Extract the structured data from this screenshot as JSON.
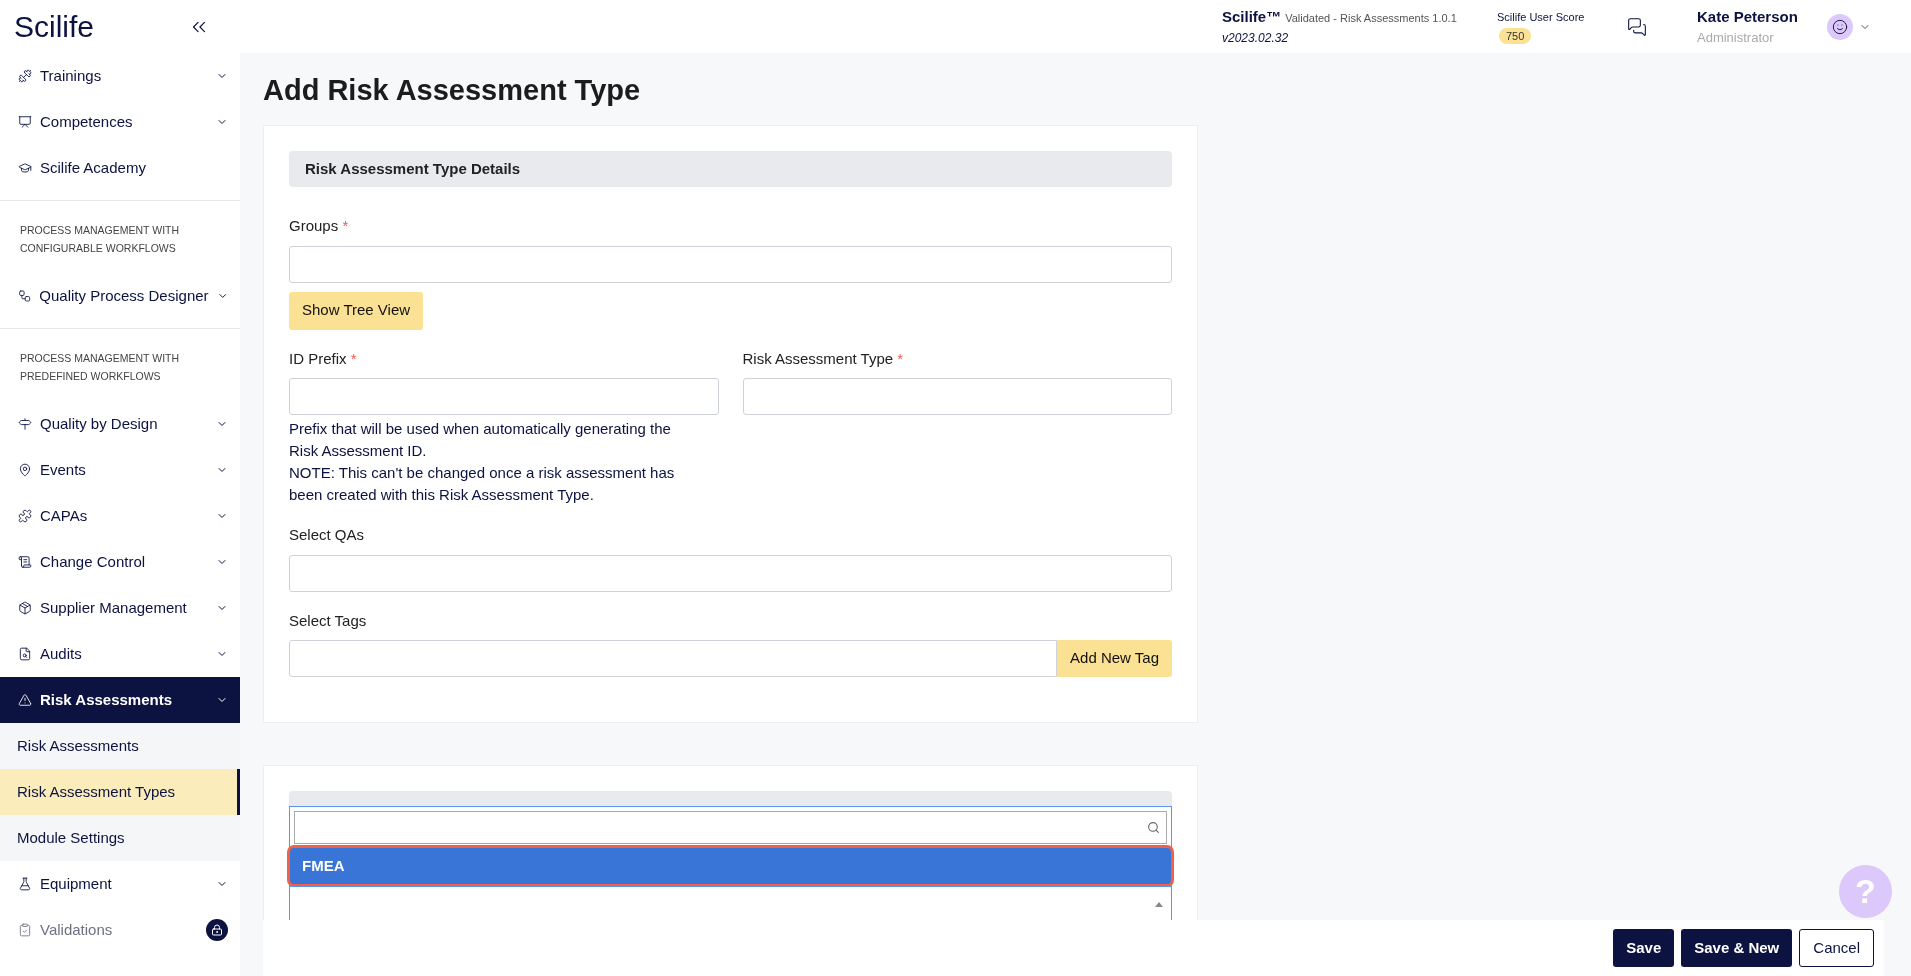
{
  "app": {
    "logo": "Scilife"
  },
  "sidebar": {
    "items": [
      {
        "kind": "group",
        "label": "Trainings",
        "expanded": false
      },
      {
        "kind": "group",
        "label": "Competences",
        "expanded": false
      },
      {
        "kind": "link",
        "label": "Scilife Academy"
      },
      {
        "kind": "heading",
        "label": "PROCESS MANAGEMENT WITH CONFIGURABLE WORKFLOWS"
      },
      {
        "kind": "group",
        "label": "Quality Process Designer",
        "expanded": false
      },
      {
        "kind": "heading",
        "label": "PROCESS MANAGEMENT WITH PREDEFINED WORKFLOWS"
      },
      {
        "kind": "group",
        "label": "Quality by Design",
        "expanded": false
      },
      {
        "kind": "group",
        "label": "Events",
        "expanded": false
      },
      {
        "kind": "group",
        "label": "CAPAs",
        "expanded": false
      },
      {
        "kind": "group",
        "label": "Change Control",
        "expanded": false
      },
      {
        "kind": "group",
        "label": "Supplier Management",
        "expanded": false
      },
      {
        "kind": "group",
        "label": "Audits",
        "expanded": false
      },
      {
        "kind": "group",
        "label": "Risk Assessments",
        "expanded": true,
        "children": [
          {
            "label": "Risk Assessments",
            "selected": false
          },
          {
            "label": "Risk Assessment Types",
            "selected": true
          },
          {
            "label": "Module Settings",
            "selected": false
          }
        ]
      },
      {
        "kind": "group",
        "label": "Equipment",
        "expanded": false
      },
      {
        "kind": "locked",
        "label": "Validations"
      }
    ]
  },
  "header": {
    "product": "Scilife™",
    "module": "Validated - Risk Assessments 1.0.1",
    "version": "v2023.02.32",
    "score_label": "Scilife User Score",
    "score": "750",
    "user": {
      "name": "Kate Peterson",
      "role": "Administrator"
    }
  },
  "page": {
    "title": "Add Risk Assessment Type"
  },
  "details": {
    "heading": "Risk Assessment Type Details",
    "fields": [
      {
        "kind": "select",
        "label": "Groups",
        "required_mark": "*",
        "button": "Show Tree View"
      },
      {
        "kind": "pair",
        "items": [
          {
            "label": "ID Prefix",
            "required_mark": "*",
            "help": [
              "Prefix that will be used when automatically generating the Risk Assessment ID.",
              "NOTE: This can't be changed once a risk assessment has been created with this Risk Assessment Type."
            ]
          },
          {
            "label": "Risk Assessment Type",
            "required_mark": "*"
          }
        ]
      },
      {
        "kind": "select",
        "label": "Select QAs"
      },
      {
        "kind": "addon",
        "label": "Select Tags",
        "button": "Add New Tag"
      }
    ]
  },
  "methodology": {
    "dropdown": {
      "expanded": true,
      "options": [
        {
          "label": "FMEA",
          "selected": true
        }
      ]
    }
  },
  "help_button": {
    "label": "?"
  },
  "actions": [
    {
      "kind": "primary",
      "label": "Save"
    },
    {
      "kind": "primary",
      "label": "Save & New"
    },
    {
      "kind": "secondary",
      "label": "Cancel"
    }
  ]
}
